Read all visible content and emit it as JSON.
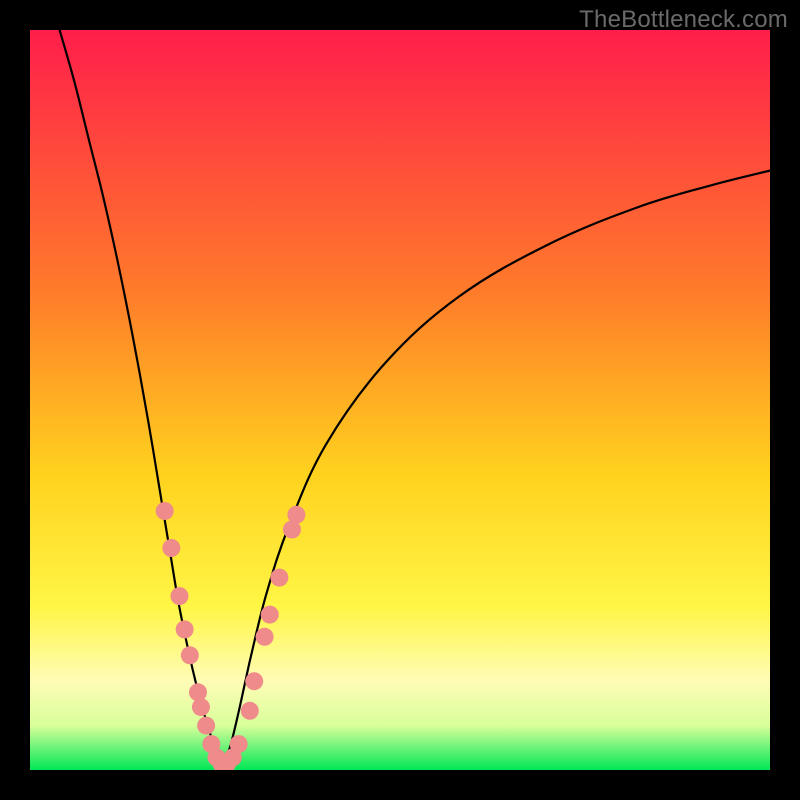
{
  "watermark": "TheBottleneck.com",
  "chart_data": {
    "type": "line",
    "title": "",
    "xlabel": "",
    "ylabel": "",
    "xlim": [
      0,
      100
    ],
    "ylim": [
      0,
      100
    ],
    "background_gradient_stops": [
      {
        "offset": 0,
        "color": "#ff1e4b"
      },
      {
        "offset": 35,
        "color": "#ff7a2a"
      },
      {
        "offset": 60,
        "color": "#ffd21e"
      },
      {
        "offset": 78,
        "color": "#fff646"
      },
      {
        "offset": 88,
        "color": "#fffcb6"
      },
      {
        "offset": 94,
        "color": "#d8ff9a"
      },
      {
        "offset": 100,
        "color": "#00e756"
      }
    ],
    "series": [
      {
        "name": "curve-left",
        "color": "#000000",
        "x": [
          4.0,
          6.0,
          8.0,
          10.0,
          12.0,
          14.0,
          16.0,
          18.0,
          19.0,
          20.0,
          21.0,
          22.0,
          23.0,
          24.0,
          24.8,
          25.5,
          26.0
        ],
        "y": [
          100.0,
          93.0,
          85.0,
          77.0,
          68.0,
          58.0,
          47.0,
          35.0,
          29.0,
          23.0,
          18.0,
          13.5,
          9.5,
          6.0,
          3.5,
          1.5,
          0.5
        ]
      },
      {
        "name": "curve-right",
        "color": "#000000",
        "x": [
          26.0,
          27.0,
          28.0,
          29.0,
          30.0,
          32.0,
          35.0,
          40.0,
          48.0,
          58.0,
          70.0,
          82.0,
          92.0,
          100.0
        ],
        "y": [
          0.5,
          3.0,
          7.0,
          11.5,
          16.0,
          24.0,
          33.0,
          44.0,
          55.0,
          64.0,
          71.0,
          76.0,
          79.0,
          81.0
        ]
      }
    ],
    "markers": {
      "name": "dots",
      "color": "#ef8b8b",
      "radius": 9,
      "points": [
        {
          "x": 18.2,
          "y": 35.0
        },
        {
          "x": 19.1,
          "y": 30.0
        },
        {
          "x": 20.2,
          "y": 23.5
        },
        {
          "x": 20.9,
          "y": 19.0
        },
        {
          "x": 21.6,
          "y": 15.5
        },
        {
          "x": 22.7,
          "y": 10.5
        },
        {
          "x": 23.1,
          "y": 8.5
        },
        {
          "x": 23.8,
          "y": 6.0
        },
        {
          "x": 24.5,
          "y": 3.5
        },
        {
          "x": 25.2,
          "y": 1.7
        },
        {
          "x": 25.9,
          "y": 0.8
        },
        {
          "x": 26.6,
          "y": 0.8
        },
        {
          "x": 27.4,
          "y": 1.7
        },
        {
          "x": 28.2,
          "y": 3.5
        },
        {
          "x": 29.7,
          "y": 8.0
        },
        {
          "x": 30.3,
          "y": 12.0
        },
        {
          "x": 31.7,
          "y": 18.0
        },
        {
          "x": 32.4,
          "y": 21.0
        },
        {
          "x": 33.7,
          "y": 26.0
        },
        {
          "x": 35.4,
          "y": 32.5
        },
        {
          "x": 36.0,
          "y": 34.5
        }
      ]
    }
  }
}
